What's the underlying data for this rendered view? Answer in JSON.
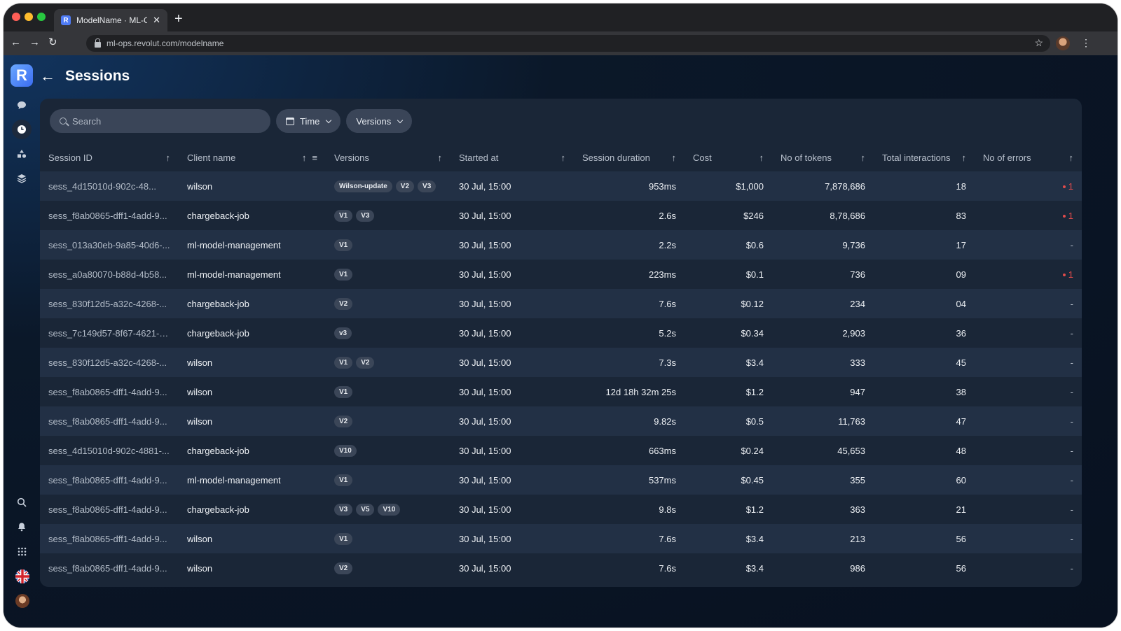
{
  "browser": {
    "tab_title": "ModelName · ML-Ops",
    "tab_favicon": "R",
    "url": "ml-ops.revolut.com/modelname",
    "traffic_colors": [
      "#ff5f57",
      "#febc2e",
      "#28c840"
    ]
  },
  "app": {
    "logo_letter": "R",
    "page_title": "Sessions",
    "sidebar_top_icons": [
      "chat-icon",
      "history-icon",
      "shapes-icon",
      "layers-icon"
    ],
    "sidebar_bottom_icons": [
      "search-icon",
      "bell-icon",
      "apps-grid-icon",
      "uk-flag-icon",
      "user-avatar"
    ]
  },
  "filters": {
    "search_placeholder": "Search",
    "time_label": "Time",
    "versions_label": "Versions"
  },
  "table": {
    "columns": [
      "Session ID",
      "Client name",
      "Versions",
      "Started at",
      "Session duration",
      "Cost",
      "No of tokens",
      "Total interactions",
      "No of errors"
    ],
    "rows": [
      {
        "session_id": "sess_4d15010d-902c-48...",
        "client": "wilson",
        "versions": [
          "Wilson-update",
          "V2",
          "V3"
        ],
        "started": "30 Jul, 15:00",
        "duration": "953ms",
        "cost": "$1,000",
        "tokens": "7,878,686",
        "interactions": "18",
        "errors": "1"
      },
      {
        "session_id": "sess_f8ab0865-dff1-4add-9...",
        "client": "chargeback-job",
        "versions": [
          "V1",
          "V3"
        ],
        "started": "30 Jul, 15:00",
        "duration": "2.6s",
        "cost": "$246",
        "tokens": "8,78,686",
        "interactions": "83",
        "errors": "1"
      },
      {
        "session_id": "sess_013a30eb-9a85-40d6-...",
        "client": "ml-model-management",
        "versions": [
          "V1"
        ],
        "started": "30 Jul, 15:00",
        "duration": "2.2s",
        "cost": "$0.6",
        "tokens": "9,736",
        "interactions": "17",
        "errors": "-"
      },
      {
        "session_id": "sess_a0a80070-b88d-4b58...",
        "client": "ml-model-management",
        "versions": [
          "V1"
        ],
        "started": "30 Jul, 15:00",
        "duration": "223ms",
        "cost": "$0.1",
        "tokens": "736",
        "interactions": "09",
        "errors": "1"
      },
      {
        "session_id": "sess_830f12d5-a32c-4268-...",
        "client": "chargeback-job",
        "versions": [
          "V2"
        ],
        "started": "30 Jul, 15:00",
        "duration": "7.6s",
        "cost": "$0.12",
        "tokens": "234",
        "interactions": "04",
        "errors": "-"
      },
      {
        "session_id": "sess_7c149d57-8f67-4621-9...",
        "client": "chargeback-job",
        "versions": [
          "v3"
        ],
        "started": "30 Jul, 15:00",
        "duration": "5.2s",
        "cost": "$0.34",
        "tokens": "2,903",
        "interactions": "36",
        "errors": "-"
      },
      {
        "session_id": "sess_830f12d5-a32c-4268-...",
        "client": "wilson",
        "versions": [
          "V1",
          "V2"
        ],
        "started": "30 Jul, 15:00",
        "duration": "7.3s",
        "cost": "$3.4",
        "tokens": "333",
        "interactions": "45",
        "errors": "-"
      },
      {
        "session_id": "sess_f8ab0865-dff1-4add-9...",
        "client": "wilson",
        "versions": [
          "V1"
        ],
        "started": "30 Jul, 15:00",
        "duration": "12d 18h 32m 25s",
        "cost": "$1.2",
        "tokens": "947",
        "interactions": "38",
        "errors": "-"
      },
      {
        "session_id": "sess_f8ab0865-dff1-4add-9...",
        "client": "wilson",
        "versions": [
          "V2"
        ],
        "started": "30 Jul, 15:00",
        "duration": "9.82s",
        "cost": "$0.5",
        "tokens": "11,763",
        "interactions": "47",
        "errors": "-"
      },
      {
        "session_id": "sess_4d15010d-902c-4881-...",
        "client": "chargeback-job",
        "versions": [
          "V10"
        ],
        "started": "30 Jul, 15:00",
        "duration": "663ms",
        "cost": "$0.24",
        "tokens": "45,653",
        "interactions": "48",
        "errors": "-"
      },
      {
        "session_id": "sess_f8ab0865-dff1-4add-9...",
        "client": "ml-model-management",
        "versions": [
          "V1"
        ],
        "started": "30 Jul, 15:00",
        "duration": "537ms",
        "cost": "$0.45",
        "tokens": "355",
        "interactions": "60",
        "errors": "-"
      },
      {
        "session_id": "sess_f8ab0865-dff1-4add-9...",
        "client": "chargeback-job",
        "versions": [
          "V3",
          "V5",
          "V10"
        ],
        "started": "30 Jul, 15:00",
        "duration": "9.8s",
        "cost": "$1.2",
        "tokens": "363",
        "interactions": "21",
        "errors": "-"
      },
      {
        "session_id": "sess_f8ab0865-dff1-4add-9...",
        "client": "wilson",
        "versions": [
          "V1"
        ],
        "started": "30 Jul, 15:00",
        "duration": "7.6s",
        "cost": "$3.4",
        "tokens": "213",
        "interactions": "56",
        "errors": "-"
      },
      {
        "session_id": "sess_f8ab0865-dff1-4add-9...",
        "client": "wilson",
        "versions": [
          "V2"
        ],
        "started": "30 Jul, 15:00",
        "duration": "7.6s",
        "cost": "$3.4",
        "tokens": "986",
        "interactions": "56",
        "errors": "-"
      }
    ]
  },
  "colors": {
    "error": "#e14b4b",
    "accent": "#4f7cf6"
  }
}
